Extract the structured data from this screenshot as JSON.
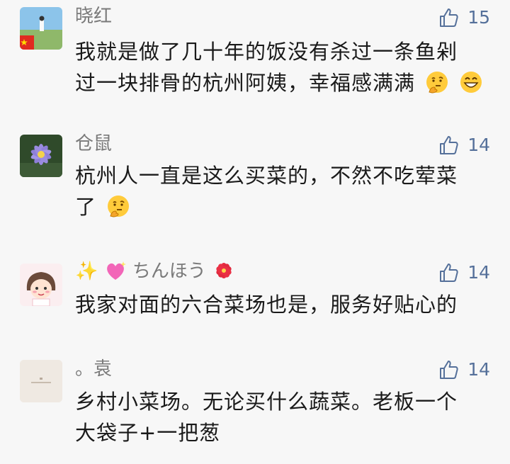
{
  "comments": [
    {
      "name": "晓红",
      "likes": "15",
      "lines": [
        "我就是做了几十年的饭没有杀过一条鱼剁",
        "过一块排骨的杭州阿姨，幸福感满满"
      ],
      "emoji_tail": [
        "thinking-face-icon",
        "grinning-face-icon"
      ],
      "avatar_icon": "landscape-flag-avatar"
    },
    {
      "name": "仓鼠",
      "likes": "14",
      "lines": [
        "杭州人一直是这么买菜的，不然不吃荤菜",
        "了"
      ],
      "emoji_tail": [
        "thinking-face-icon"
      ],
      "avatar_icon": "water-lily-avatar"
    },
    {
      "name": "ちんほう",
      "name_prefix_icons": [
        "sparkles-icon",
        "sparkling-heart-icon"
      ],
      "name_suffix_icons": [
        "hibiscus-icon"
      ],
      "likes": "14",
      "lines": [
        "我家对面的六合菜场也是，服务好贴心的"
      ],
      "avatar_icon": "cartoon-girl-avatar"
    },
    {
      "name": "。袁",
      "likes": "14",
      "lines": [
        "乡村小菜场。无论买什么蔬菜。老板一个",
        "大袋子+一把葱"
      ],
      "avatar_icon": "plain-card-avatar"
    }
  ],
  "colors": {
    "background": "#f7f7f7",
    "name": "#7a7a7a",
    "likes": "#55709a",
    "text": "#1a1a1a"
  }
}
